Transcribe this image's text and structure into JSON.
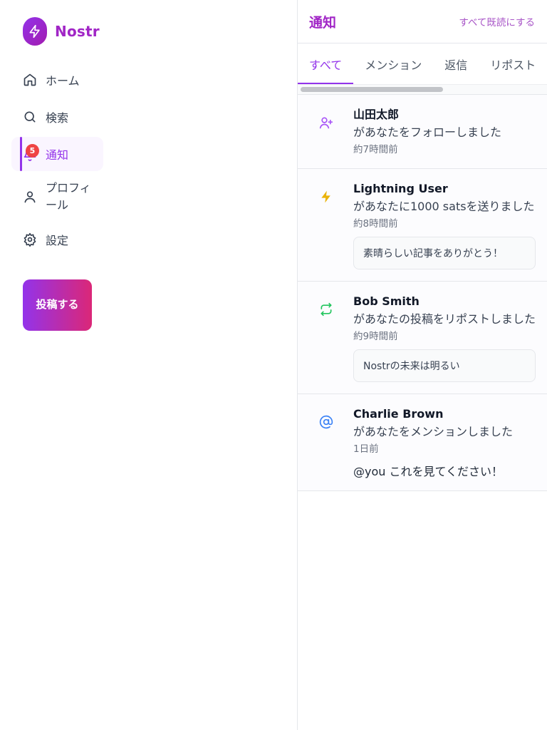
{
  "app": {
    "name": "Nostr"
  },
  "nav": {
    "items": [
      {
        "label": "ホーム",
        "icon": "home-icon"
      },
      {
        "label": "検索",
        "icon": "search-icon"
      },
      {
        "label": "通知",
        "icon": "bell-icon",
        "badge": "5",
        "active": true
      },
      {
        "label": "プロフィール",
        "icon": "user-icon"
      },
      {
        "label": "設定",
        "icon": "gear-icon"
      }
    ],
    "post_button": "投稿する"
  },
  "header": {
    "title": "通知",
    "mark_all_read": "すべて既読にする"
  },
  "tabs": [
    {
      "label": "すべて",
      "active": true
    },
    {
      "label": "メンション"
    },
    {
      "label": "返信"
    },
    {
      "label": "リポスト"
    }
  ],
  "notifications": [
    {
      "type": "follow",
      "icon": "user-plus-icon",
      "color": "#a855f7",
      "name": "山田太郎",
      "action": "があなたをフォローしました",
      "time": "約7時間前"
    },
    {
      "type": "zap",
      "icon": "lightning-icon",
      "color": "#eab308",
      "name": "Lightning User",
      "action": "があなたに1000 satsを送りました",
      "time": "約8時間前",
      "quote": "素晴らしい記事をありがとう！"
    },
    {
      "type": "repost",
      "icon": "repost-icon",
      "color": "#22c55e",
      "name": "Bob Smith",
      "action": "があなたの投稿をリポストしました",
      "time": "約9時間前",
      "quote": "Nostrの未来は明るい"
    },
    {
      "type": "mention",
      "icon": "at-icon",
      "color": "#3b82f6",
      "name": "Charlie Brown",
      "action": "があなたをメンションしました",
      "time": "1日前",
      "text": "@you これを見てください！"
    }
  ],
  "colors": {
    "accent": "#9333ea",
    "badge": "#ef4444"
  }
}
